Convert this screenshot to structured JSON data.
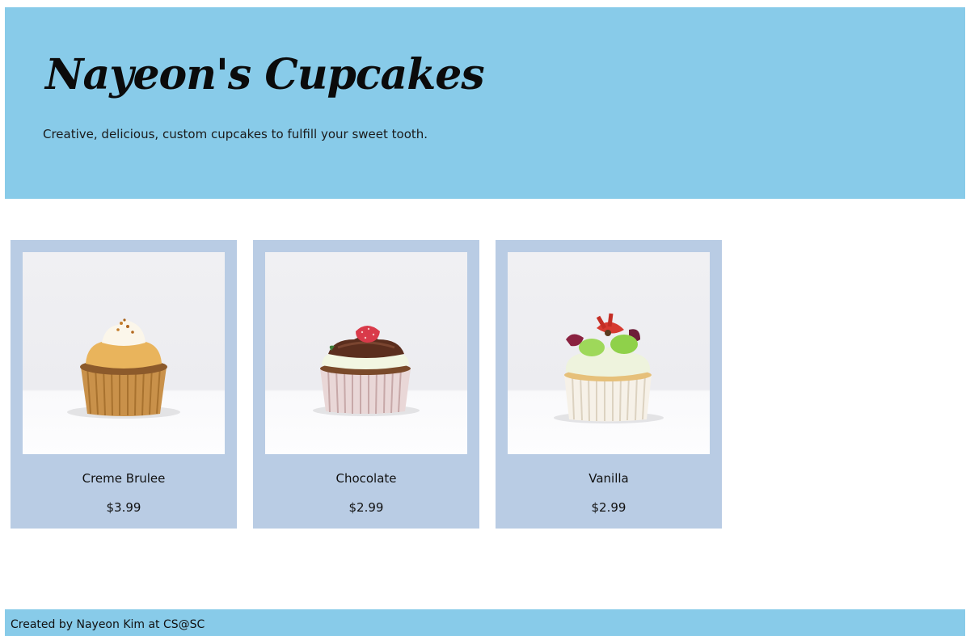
{
  "header": {
    "title": "Nayeon's Cupcakes",
    "tagline": "Creative, delicious, custom cupcakes to fulfill your sweet tooth.",
    "background_color": "#88cbe9"
  },
  "products": [
    {
      "name": "Creme Brulee",
      "price": "$3.99",
      "frosting_color": "#f3e6c4",
      "topping": "caramelized sugar"
    },
    {
      "name": "Chocolate",
      "price": "$2.99",
      "frosting_color": "#5b2e1e",
      "topping": "raspberry"
    },
    {
      "name": "Vanilla",
      "price": "$2.99",
      "frosting_color": "#eef3dd",
      "topping": "fruit"
    }
  ],
  "card_color": "#b9cce4",
  "footer": {
    "text": "Created by Nayeon Kim at CS@SC"
  }
}
